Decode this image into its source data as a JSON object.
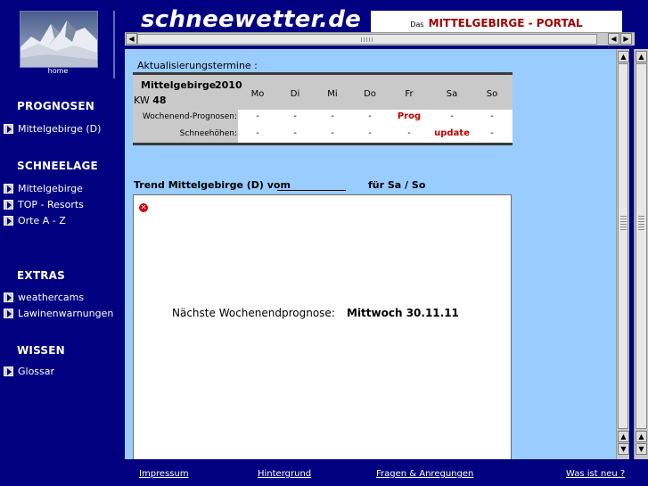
{
  "sidebar": {
    "home_label": "home",
    "sections": [
      {
        "title": "PROGNOSEN",
        "items": [
          "Mittelgebirge (D)"
        ]
      },
      {
        "title": "SCHNEELAGE",
        "items": [
          "Mittelgebirge",
          "TOP - Resorts",
          "Orte A - Z"
        ]
      },
      {
        "title": "EXTRAS",
        "items": [
          "weathercams",
          "Lawinenwarnungen"
        ]
      },
      {
        "title": "WISSEN",
        "items": [
          "Glossar"
        ]
      }
    ]
  },
  "header": {
    "site_title": "schneewetter.de",
    "portal_prefix": "Das",
    "portal_title": "MITTELGEBIRGE - PORTAL",
    "accent_color": "#a00000"
  },
  "schedule": {
    "caption": "Aktualisierungstermine :",
    "region": "Mittelgebirge",
    "year": "2010",
    "kw_label": "KW",
    "kw_value": "48",
    "days": [
      "Mo",
      "Di",
      "Mi",
      "Do",
      "Fr",
      "Sa",
      "So"
    ],
    "rows": [
      {
        "label": "Wochenend-Prognosen:",
        "cells": [
          "-",
          "-",
          "-",
          "-",
          "Prog",
          "-",
          "-"
        ]
      },
      {
        "label": "Schneehöhen:",
        "cells": [
          "-",
          "-",
          "-",
          "-",
          "-",
          "update",
          "-"
        ]
      }
    ]
  },
  "trend": {
    "title": "Trend Mittelgebirge (D) vom",
    "weekend": "für Sa / So",
    "next_label": "Nächste Wochenendprognose:",
    "next_value": "Mittwoch  30.11.11"
  },
  "footer": {
    "links": [
      "Impressum",
      "Hintergrund",
      "Fragen & Anregungen",
      "Was ist neu ?"
    ]
  },
  "icons": {
    "broken_image": "broken-image-icon",
    "nav_bullet": "triangle-right-icon"
  }
}
